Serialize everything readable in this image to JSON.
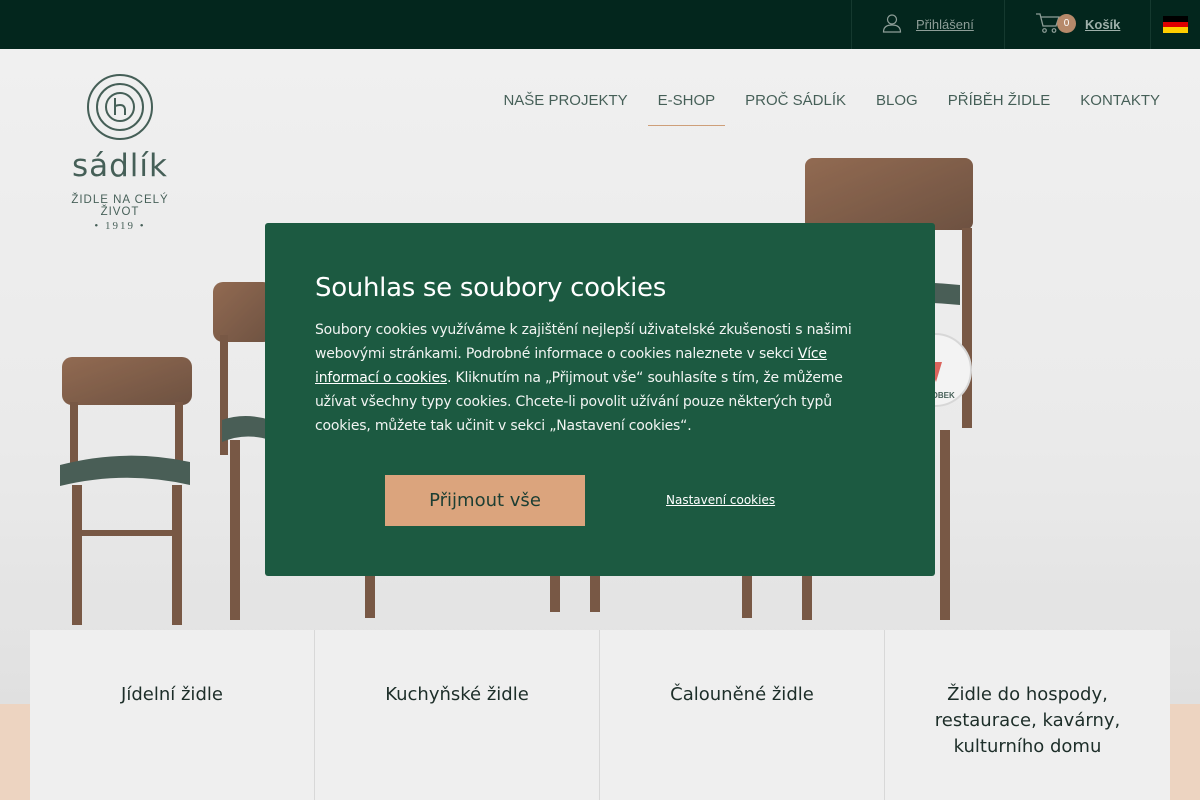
{
  "topbar": {
    "login_label": "Přihlášení",
    "cart_label": "Košík",
    "cart_count": "0",
    "language_flag": "german-flag"
  },
  "brand": {
    "name": "sádlík",
    "tagline": "ŽIDLE NA CELÝ ŽIVOT",
    "year": "• 1919 •"
  },
  "nav": {
    "items": [
      {
        "label": "NAŠE PROJEKTY"
      },
      {
        "label": "E-SHOP"
      },
      {
        "label": "PROČ SÁDLÍK"
      },
      {
        "label": "BLOG"
      },
      {
        "label": "PŘÍBĚH ŽIDLE"
      },
      {
        "label": "KONTAKTY"
      }
    ]
  },
  "badge": {
    "text": "VÝROBEK"
  },
  "cookie_modal": {
    "title": "Souhlas se soubory cookies",
    "text_1": "Soubory cookies využíváme k zajištění nejlepší uživatelské zkušenosti s našimi webovými stránkami. Podrobné informace o cookies naleznete v sekci ",
    "link": "Více informací o cookies",
    "text_2": ". Kliknutím na „Přijmout vše“ souhlasíte s tím, že můžeme užívat všechny typy cookies. Chcete-li povolit užívání pouze některých typů cookies, můžete tak učinit v sekci „Nastavení cookies“.",
    "accept_label": "Přijmout vše",
    "settings_label": "Nastavení cookies"
  },
  "categories": [
    {
      "label": "Jídelní židle"
    },
    {
      "label": "Kuchyňské židle"
    },
    {
      "label": "Čalouněné židle"
    },
    {
      "label": "Židle do hospody, restaurace, kavárny, kulturního domu"
    }
  ],
  "colors": {
    "topbar": "#03261d",
    "modal": "#1c5a41",
    "accent": "#dba47d",
    "nav_active_underline": "#c48a5c"
  }
}
